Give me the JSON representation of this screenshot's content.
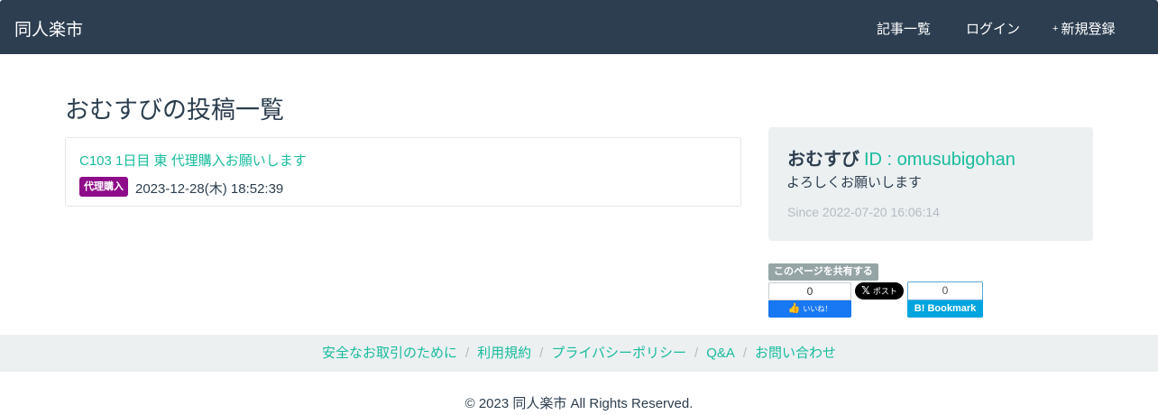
{
  "navbar": {
    "brand": "同人楽市",
    "items": [
      {
        "icon": "list-icon",
        "icon_glyph": "",
        "label": "記事一覧"
      },
      {
        "icon": "sign-in-icon",
        "icon_glyph": "",
        "label": "ログイン"
      },
      {
        "icon": "plus-icon",
        "icon_glyph": "+",
        "label": "新規登録"
      }
    ]
  },
  "main": {
    "title": "おむすびの投稿一覧",
    "posts": [
      {
        "title": "C103 1日目 東 代理購入お願いします",
        "tag": "代理購入",
        "tag_color": "#8e0c8a",
        "date": "2023-12-28(木) 18:52:39"
      }
    ]
  },
  "profile": {
    "icon_glyph": "",
    "name": "おむすび",
    "id": "ID : omusubigohan",
    "bio": "よろしくお願いします",
    "since_icon_glyph": "",
    "since": "Since 2022-07-20 16:06:14"
  },
  "share": {
    "label": "このページを共有する",
    "facebook": {
      "count": "0",
      "label": "いいね！"
    },
    "x": {
      "label": "ポスト"
    },
    "hatena": {
      "count": "0",
      "label": "Bookmark",
      "logo": "B!"
    }
  },
  "footer": {
    "links": [
      "安全なお取引のために",
      "利用規約",
      "プライバシーポリシー",
      "Q&A",
      "お問い合わせ"
    ],
    "separator": "/",
    "copyright": "© 2023 同人楽市 All Rights Reserved."
  },
  "colors": {
    "navbar_bg": "#2c3e50",
    "accent": "#18bc9c",
    "panel_bg": "#ecf0f1",
    "muted": "#b4bcc2"
  }
}
